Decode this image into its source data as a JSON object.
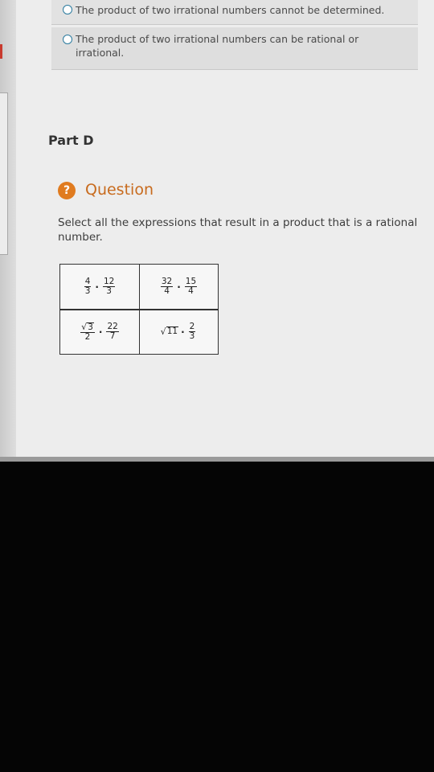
{
  "options": [
    {
      "label": "The product of two irrational numbers cannot be determined."
    },
    {
      "label": "The product of two irrational numbers can be rational or irrational."
    }
  ],
  "part": {
    "title": "Part D"
  },
  "question": {
    "icon": "question-mark-icon",
    "icon_glyph": "?",
    "label": "Question",
    "prompt": "Select all the expressions that result in a product that is a rational number."
  },
  "expressions": [
    {
      "a_num": "4",
      "a_den": "3",
      "b_num": "12",
      "b_den": "3"
    },
    {
      "a_num": "32",
      "a_den": "4",
      "b_num": "15",
      "b_den": "4"
    },
    {
      "a_num": "√3",
      "a_rad": "3",
      "a_den": "2",
      "b_num": "22",
      "b_den": "7"
    },
    {
      "a_rad": "11",
      "b_num": "2",
      "b_den": "3"
    }
  ],
  "colors": {
    "accent": "#e07b1f",
    "radio": "#2a7a9e"
  }
}
